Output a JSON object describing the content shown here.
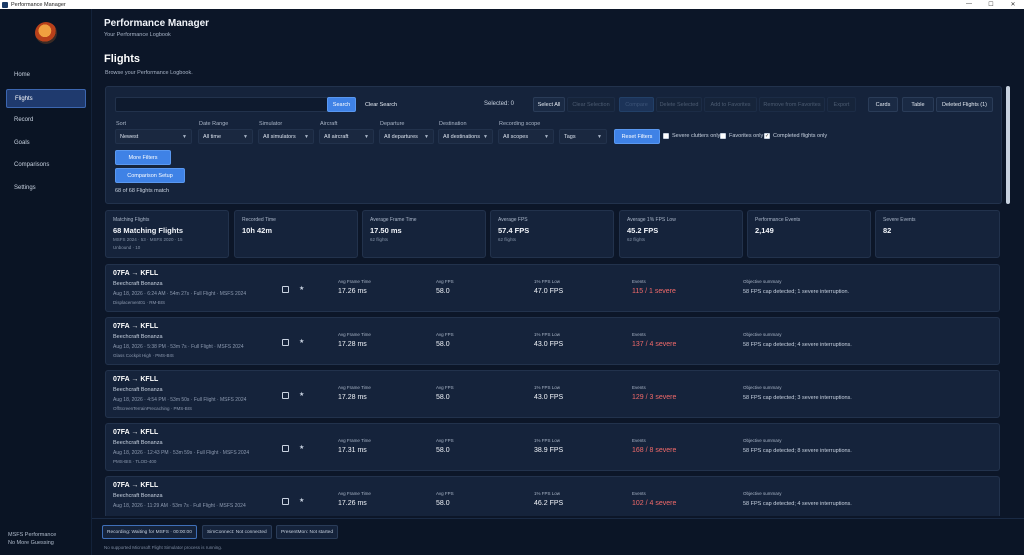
{
  "window": {
    "title": "Performance Manager",
    "controls": [
      "—",
      "☐",
      "✕"
    ]
  },
  "sidebar": {
    "items": [
      {
        "label": "Home",
        "active": false
      },
      {
        "label": "Flights",
        "active": true
      },
      {
        "label": "Record",
        "active": false
      },
      {
        "label": "Goals",
        "active": false
      },
      {
        "label": "Comparisons",
        "active": false
      },
      {
        "label": "Settings",
        "active": false
      }
    ],
    "footer_line1": "MSFS Performance",
    "footer_line2": "No More Guessing"
  },
  "header": {
    "app_title": "Performance Manager",
    "app_subtitle": "Your Performance Logbook",
    "page_title": "Flights",
    "page_subtitle": "Browse your Performance Logbook."
  },
  "toolbar": {
    "search_value": "",
    "search_label": "Search",
    "clear_search_label": "Clear Search",
    "selected_label": "Selected: 0",
    "select_all_label": "Select All",
    "clear_selection_label": "Clear Selection",
    "compare_label": "Compare",
    "delete_selected_label": "Delete Selected",
    "add_favorites_label": "Add to Favorites",
    "remove_favorites_label": "Remove from Favorites",
    "export_label": "Export",
    "view_cards_label": "Cards",
    "view_table_label": "Table",
    "deleted_flights_label": "Deleted Flights (1)"
  },
  "filters": {
    "sort_label": "Sort",
    "sort_value": "Newest",
    "date_label": "Date Range",
    "date_value": "All time",
    "simulator_label": "Simulator",
    "simulator_value": "All simulators",
    "aircraft_label": "Aircraft",
    "aircraft_value": "All aircraft",
    "departure_label": "Departure",
    "departure_value": "All departures",
    "destination_label": "Destination",
    "destination_value": "All destinations",
    "scope_label": "Recording scope",
    "scope_value": "All scopes",
    "tags_value": "Tags",
    "reset_label": "Reset Filters",
    "severe_only_label": "Severe clutters only",
    "favorites_only_label": "Favorites only",
    "completed_only_label": "Completed flights only",
    "severe_only_checked": false,
    "favorites_only_checked": false,
    "completed_only_checked": true,
    "more_filters_label": "More Filters",
    "comparison_setup_label": "Comparison Setup",
    "match_count": "68 of 68 Flights match"
  },
  "stats": [
    {
      "label": "Matching Flights",
      "value": "68 Matching Flights",
      "sub": "MSFS 2024 · 53 · MSFS 2020 · 15",
      "sub2": "Unbound · 10"
    },
    {
      "label": "Recorded Time",
      "value": "10h 42m",
      "sub": "",
      "sub2": ""
    },
    {
      "label": "Average Frame Time",
      "value": "17.50 ms",
      "sub": "62 flights",
      "sub2": ""
    },
    {
      "label": "Average FPS",
      "value": "57.4 FPS",
      "sub": "62 flights",
      "sub2": ""
    },
    {
      "label": "Average 1% FPS Low",
      "value": "45.2 FPS",
      "sub": "62 flights",
      "sub2": ""
    },
    {
      "label": "Performance Events",
      "value": "2,149",
      "sub": "",
      "sub2": ""
    },
    {
      "label": "Severe Events",
      "value": "82",
      "sub": "",
      "sub2": ""
    }
  ],
  "flight_labels": {
    "frame_time": "Avg Frame Time",
    "fps": "Avg FPS",
    "low": "1% FPS Low",
    "events": "Events",
    "summary": "Objective summary"
  },
  "flights": [
    {
      "route": "07FA → KFLL",
      "aircraft": "Beechcraft Bonanza",
      "meta": "Aug 18, 2026 · 6:24 AM · 54m 27s · Full Flight · MSFS 2024",
      "tags": "Displacement01 · RM-BIS",
      "frame_time": "17.26 ms",
      "fps": "58.0",
      "low": "47.0 FPS",
      "events": "115 / 1 severe",
      "summary": "58 FPS cap detected; 1 severe interruption."
    },
    {
      "route": "07FA → KFLL",
      "aircraft": "Beechcraft Bonanza",
      "meta": "Aug 18, 2026 · 5:38 PM · 53m 7s · Full Flight · MSFS 2024",
      "tags": "Glass Cockpit High · PMS-BIS",
      "frame_time": "17.28 ms",
      "fps": "58.0",
      "low": "43.0 FPS",
      "events": "137 / 4 severe",
      "summary": "58 FPS cap detected; 4 severe interruptions."
    },
    {
      "route": "07FA → KFLL",
      "aircraft": "Beechcraft Bonanza",
      "meta": "Aug 18, 2026 · 4:54 PM · 53m 50s · Full Flight · MSFS 2024",
      "tags": "OffScreenTerrainPrecaching · PMS-BIS",
      "frame_time": "17.28 ms",
      "fps": "58.0",
      "low": "43.0 FPS",
      "events": "129 / 3 severe",
      "summary": "58 FPS cap detected; 3 severe interruptions."
    },
    {
      "route": "07FA → KFLL",
      "aircraft": "Beechcraft Bonanza",
      "meta": "Aug 18, 2026 · 12:43 PM · 53m 59s · Full Flight · MSFS 2024",
      "tags": "PMS-BIS · TLOD-400",
      "frame_time": "17.31 ms",
      "fps": "58.0",
      "low": "38.9 FPS",
      "events": "168 / 8 severe",
      "summary": "58 FPS cap detected; 8 severe interruptions."
    },
    {
      "route": "07FA → KFLL",
      "aircraft": "Beechcraft Bonanza",
      "meta": "Aug 18, 2026 · 11:29 AM · 53m 7s · Full Flight · MSFS 2024",
      "tags": "",
      "frame_time": "17.26 ms",
      "fps": "58.0",
      "low": "46.2 FPS",
      "events": "102 / 4 severe",
      "summary": "58 FPS cap detected; 4 severe interruptions."
    }
  ],
  "status_bar": {
    "recording": "Recording: Waiting for MSFS · 00:00:00",
    "simconnect": "SimConnect: Not connected",
    "presentmon": "PresentMon: Not started",
    "note": "No supported Microsoft Flight Simulator process is running."
  },
  "colors": {
    "accent": "#3f82e6",
    "severe": "#f26a6a",
    "background": "#0c1628",
    "panel": "#15233b"
  }
}
